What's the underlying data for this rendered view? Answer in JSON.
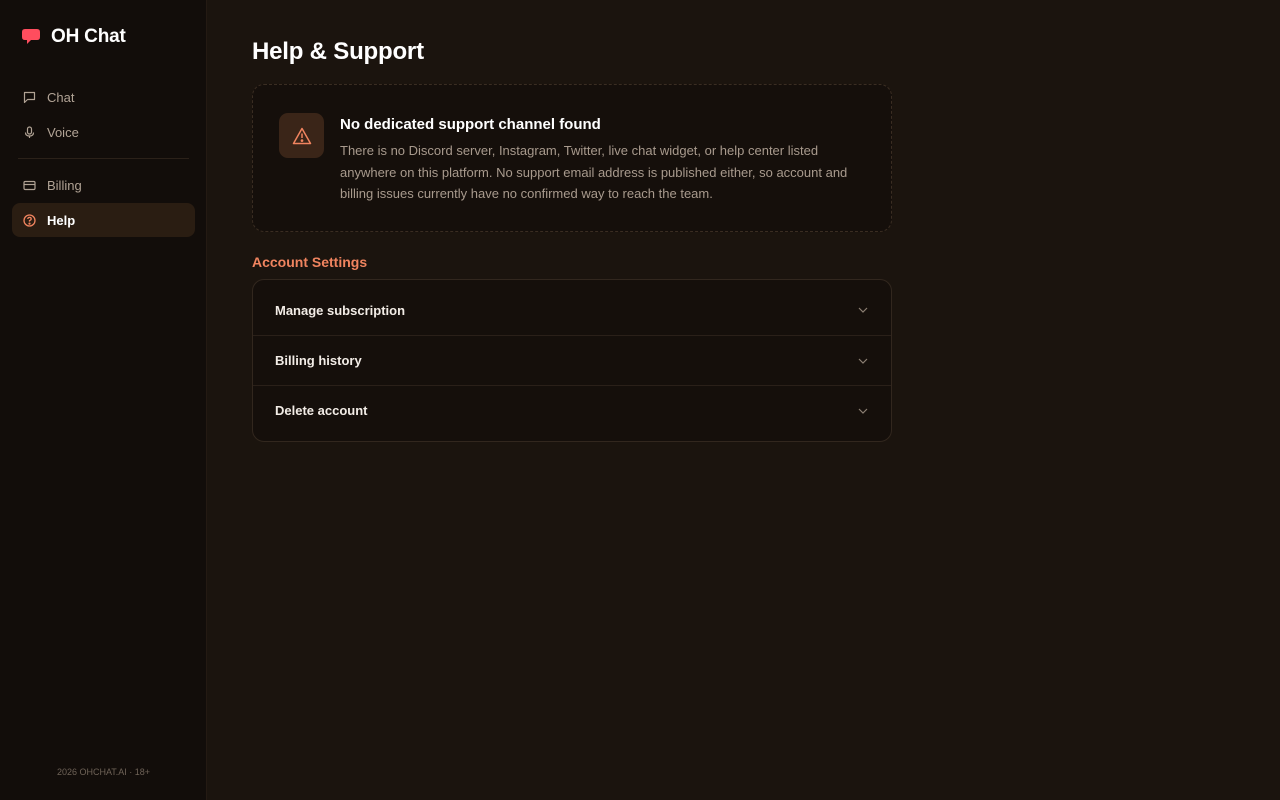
{
  "brand": {
    "name": "OH Chat",
    "icon": "speech-bubble-icon",
    "color": "#ff4d5e"
  },
  "sidebar": {
    "items": [
      {
        "label": "Chat",
        "icon": "message-square-icon",
        "active": false
      },
      {
        "label": "Voice",
        "icon": "microphone-icon",
        "active": false
      },
      {
        "label": "Billing",
        "icon": "credit-card-icon",
        "active": false
      },
      {
        "label": "Help",
        "icon": "help-circle-icon",
        "active": true
      }
    ],
    "footer": "2026 OHCHAT.AI · 18+"
  },
  "main": {
    "title": "Help & Support",
    "notice": {
      "icon": "warning-triangle-icon",
      "title": "No dedicated support channel found",
      "body": "There is no Discord server, Instagram, Twitter, live chat widget, or help center listed anywhere on this platform. No support email address is published either, so account and billing issues currently have no confirmed way to reach the team."
    },
    "account_settings": {
      "label": "Account Settings",
      "rows": [
        {
          "label": "Manage subscription"
        },
        {
          "label": "Billing history"
        },
        {
          "label": "Delete account"
        }
      ]
    }
  },
  "colors": {
    "accent": "#f0845f",
    "background": "#1b140e",
    "sidebar": "#120d0a"
  }
}
